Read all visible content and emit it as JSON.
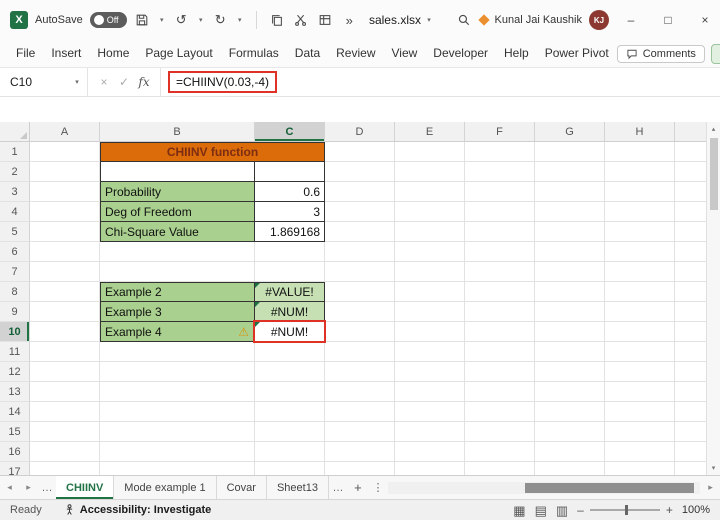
{
  "colors": {
    "excel_green": "#217346",
    "title_fill": "#DC6B0A",
    "title_text": "#7C2D12",
    "cell_green": "#A9D08E",
    "cell_light_green": "#C6E0B4",
    "annotation_red": "#DE3226",
    "avatar_bg": "#8C3A31",
    "gem_orange": "#E98F2E",
    "warning_orange": "#D89614"
  },
  "icons": {
    "excel_logo_letter": "X",
    "chevron_down": "▾",
    "undo": "↺",
    "redo": "↻",
    "more_commands": "»",
    "cancel": "×",
    "enter": "✓",
    "function": "fx",
    "warning": "⚠",
    "ellipsis": "…",
    "plus": "+",
    "kebab": "⋮",
    "arrow_up": "▴",
    "arrow_down": "▾",
    "arrow_left": "◂",
    "arrow_right": "▸",
    "view_normal": "▦",
    "view_page_layout": "▤",
    "view_page_break": "▥",
    "zoom_out": "–",
    "zoom_in": "+",
    "minimize": "–",
    "maximize": "□",
    "close": "×"
  },
  "titlebar": {
    "autosave_label": "AutoSave",
    "autosave_state": "Off",
    "filename": "sales.xlsx",
    "user_name": "Kunal Jai Kaushik",
    "user_initials": "KJ"
  },
  "ribbon": {
    "tabs": [
      "File",
      "Insert",
      "Home",
      "Page Layout",
      "Formulas",
      "Data",
      "Review",
      "View",
      "Developer",
      "Help",
      "Power Pivot"
    ],
    "comments_label": "Comments"
  },
  "formula_bar": {
    "name_box": "C10",
    "formula": "=CHIINV(0.03,-4)"
  },
  "sheet": {
    "columns": [
      "A",
      "B",
      "C",
      "D",
      "E",
      "F",
      "G",
      "H"
    ],
    "row_count": 17,
    "selected": {
      "column": "C",
      "row": 10
    },
    "cells": [
      {
        "ref": "B1",
        "text": "CHIINV function",
        "type": "title",
        "colspan": 2,
        "edges": "tlrb"
      },
      {
        "ref": "B2",
        "type": "blank",
        "edges": "lrb"
      },
      {
        "ref": "C2",
        "type": "blank",
        "edges": "rb"
      },
      {
        "ref": "B3",
        "text": "Probability",
        "type": "label",
        "edges": "lrb"
      },
      {
        "ref": "C3",
        "text": "0.6",
        "type": "number",
        "edges": "rb"
      },
      {
        "ref": "B4",
        "text": "Deg of Freedom",
        "type": "label",
        "edges": "lrb"
      },
      {
        "ref": "C4",
        "text": "3",
        "type": "number",
        "edges": "rb"
      },
      {
        "ref": "B5",
        "text": "Chi-Square Value",
        "type": "label",
        "edges": "lrb"
      },
      {
        "ref": "C5",
        "text": "1.869168",
        "type": "number",
        "edges": "rb"
      },
      {
        "ref": "B8",
        "text": "Example 2",
        "type": "label",
        "edges": "tlrb"
      },
      {
        "ref": "C8",
        "text": "#VALUE!",
        "type": "error",
        "edges": "trb",
        "indicator": true
      },
      {
        "ref": "B9",
        "text": "Example 3",
        "type": "label",
        "edges": "lrb"
      },
      {
        "ref": "C9",
        "text": "#NUM!",
        "type": "error",
        "edges": "rb",
        "indicator": true
      },
      {
        "ref": "B10",
        "text": "Example 4",
        "type": "label",
        "edges": "lrb",
        "warning": true
      },
      {
        "ref": "C10",
        "text": "#NUM!",
        "type": "error",
        "fill": "white",
        "edges": "rb",
        "indicator": true,
        "selected": true
      }
    ]
  },
  "sheet_tabs": {
    "tabs": [
      {
        "label": "CHIINV",
        "active": true
      },
      {
        "label": "Mode example 1",
        "active": false
      },
      {
        "label": "Covar",
        "active": false
      },
      {
        "label": "Sheet13",
        "active": false
      }
    ]
  },
  "status_bar": {
    "mode": "Ready",
    "accessibility": "Accessibility: Investigate",
    "zoom": "100%"
  }
}
